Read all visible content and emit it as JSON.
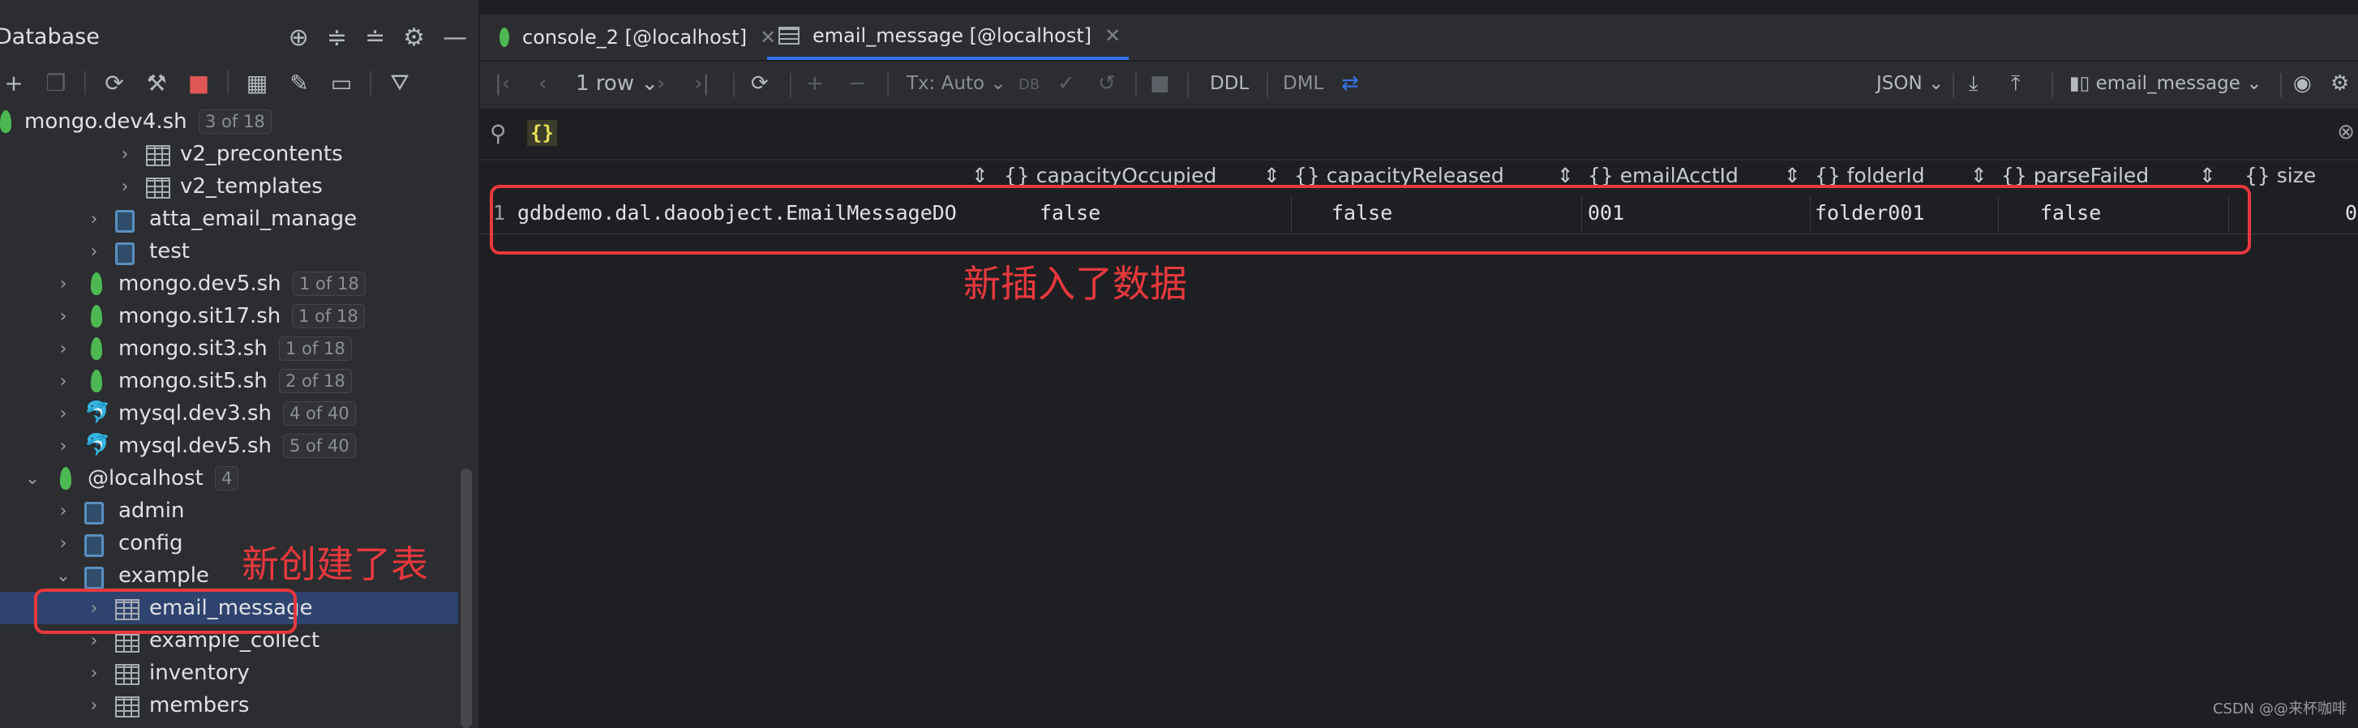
{
  "sidebar": {
    "title": "Database",
    "tree": [
      {
        "label": "mongo.dev4.sh",
        "badge": "3 of 18",
        "type": "mongo",
        "level": 0,
        "arrow": ""
      },
      {
        "label": "v2_precontents",
        "type": "table",
        "level": 3,
        "arrow": "›"
      },
      {
        "label": "v2_templates",
        "type": "table",
        "level": 3,
        "arrow": "›"
      },
      {
        "label": "atta_email_manage",
        "type": "db",
        "level": 2,
        "arrow": "›"
      },
      {
        "label": "test",
        "type": "db",
        "level": 2,
        "arrow": "›"
      },
      {
        "label": "mongo.dev5.sh",
        "badge": "1 of 18",
        "type": "mongo",
        "level": 1,
        "arrow": "›"
      },
      {
        "label": "mongo.sit17.sh",
        "badge": "1 of 18",
        "type": "mongo",
        "level": 1,
        "arrow": "›"
      },
      {
        "label": "mongo.sit3.sh",
        "badge": "1 of 18",
        "type": "mongo",
        "level": 1,
        "arrow": "›"
      },
      {
        "label": "mongo.sit5.sh",
        "badge": "2 of 18",
        "type": "mongo",
        "level": 1,
        "arrow": "›"
      },
      {
        "label": "mysql.dev3.sh",
        "badge": "4 of 40",
        "type": "mysql",
        "level": 1,
        "arrow": "›"
      },
      {
        "label": "mysql.dev5.sh",
        "badge": "5 of 40",
        "type": "mysql",
        "level": 1,
        "arrow": "›"
      },
      {
        "label": "@localhost",
        "badge": "4",
        "type": "mongo",
        "level": 0,
        "arrow": "⌄"
      },
      {
        "label": "admin",
        "type": "db",
        "level": 1,
        "arrow": "›"
      },
      {
        "label": "config",
        "type": "db",
        "level": 1,
        "arrow": "›"
      },
      {
        "label": "example",
        "type": "db",
        "level": 1,
        "arrow": "⌄"
      },
      {
        "label": "email_message",
        "type": "table",
        "level": 2,
        "arrow": "›",
        "selected": true
      },
      {
        "label": "example_collect",
        "type": "table",
        "level": 2,
        "arrow": "›"
      },
      {
        "label": "inventory",
        "type": "table",
        "level": 2,
        "arrow": "›"
      },
      {
        "label": "members",
        "type": "table",
        "level": 2,
        "arrow": "›"
      }
    ],
    "annotation": "新创建了表"
  },
  "tabs": [
    {
      "label": "console_2 [@localhost]",
      "active": false
    },
    {
      "label": "email_message [@localhost]",
      "active": true
    }
  ],
  "toolbar": {
    "rows": "1 row",
    "tx": "Tx: Auto",
    "ddl": "DDL",
    "dml": "DML",
    "format": "JSON",
    "collection": "email_message"
  },
  "filter": {
    "value": "{}"
  },
  "grid": {
    "columns": [
      "{} capacityOccupied",
      "{} capacityReleased",
      "{} emailAcctId",
      "{} folderId",
      "{} parseFailed",
      "{} size"
    ],
    "row_number": "1",
    "row": [
      "gdbdemo.dal.daoobject.EmailMessageDO",
      "false",
      "false",
      "001",
      "folder001",
      "false",
      "0"
    ],
    "annotation": "新插入了数据"
  },
  "colors": {
    "highlight": "#e8383d",
    "accent": "#3574f0",
    "mongo_leaf": "#4db852"
  },
  "watermark": "CSDN @@来杯咖啡"
}
